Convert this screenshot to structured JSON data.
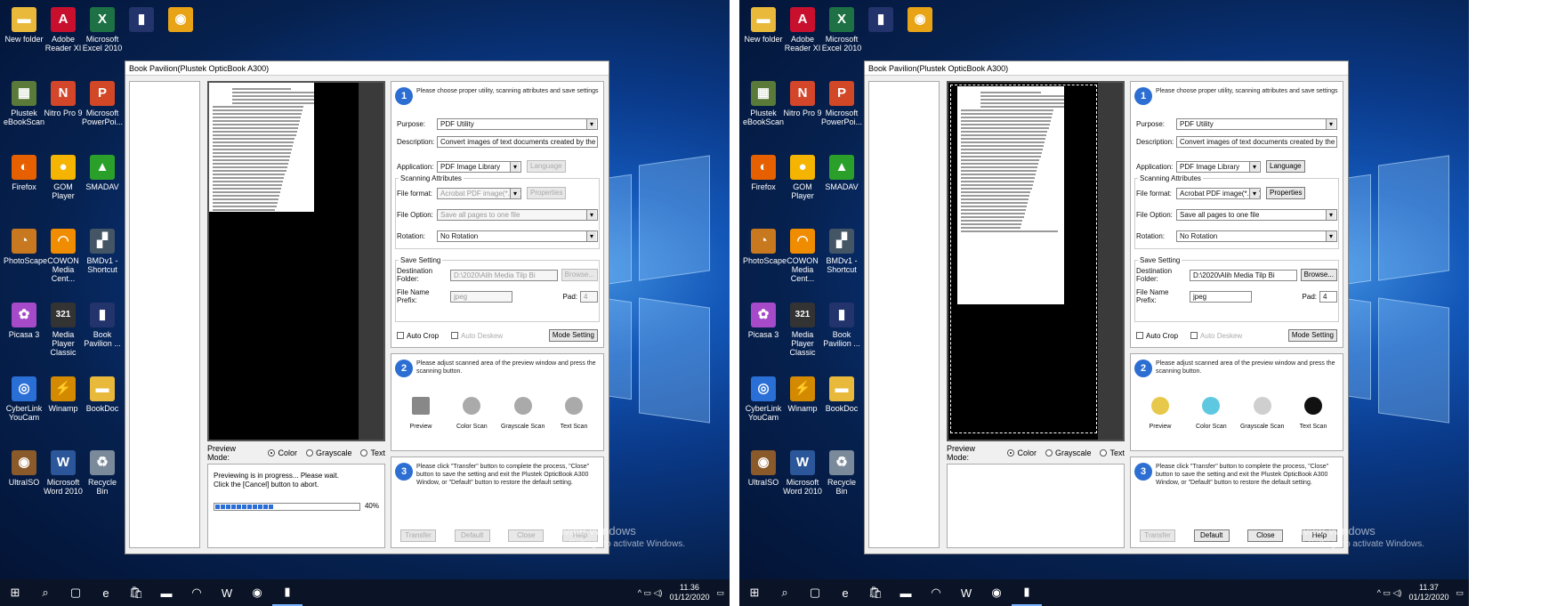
{
  "desktop": {
    "icons": [
      {
        "label": "New folder",
        "icon": "folder-icon",
        "color": "#e8b93a",
        "glyph": "▬"
      },
      {
        "label": "Adobe Reader XI",
        "icon": "adobe-reader-icon",
        "color": "#c8102e",
        "glyph": "A"
      },
      {
        "label": "Microsoft Excel 2010",
        "icon": "excel-icon",
        "color": "#1e7145",
        "glyph": "X"
      },
      {
        "label": "",
        "icon": "book-pavilion-small-icon",
        "color": "#23336b",
        "glyph": "▮"
      },
      {
        "label": "",
        "icon": "chrome-icon",
        "color": "#e8a317",
        "glyph": "◉"
      },
      {
        "label": "Plustek eBookScan",
        "icon": "plustek-icon",
        "color": "#5a7a3a",
        "glyph": "▦"
      },
      {
        "label": "Nitro Pro 9",
        "icon": "nitro-icon",
        "color": "#d4462a",
        "glyph": "N"
      },
      {
        "label": "Microsoft PowerPoi...",
        "icon": "powerpoint-icon",
        "color": "#d24726",
        "glyph": "P"
      },
      {
        "label": "Firefox",
        "icon": "firefox-icon",
        "color": "#e66000",
        "glyph": "◐"
      },
      {
        "label": "GOM Player",
        "icon": "gom-player-icon",
        "color": "#f5b400",
        "glyph": "●"
      },
      {
        "label": "SMADAV",
        "icon": "smadav-icon",
        "color": "#2aa02a",
        "glyph": "▲"
      },
      {
        "label": "PhotoScape",
        "icon": "photoscape-icon",
        "color": "#c8781e",
        "glyph": "◔"
      },
      {
        "label": "COWON Media Cent...",
        "icon": "cowon-icon",
        "color": "#f08c00",
        "glyph": "◠"
      },
      {
        "label": "BMDv1 - Shortcut",
        "icon": "bmdv1-icon",
        "color": "#445566",
        "glyph": "▞"
      },
      {
        "label": "Picasa 3",
        "icon": "picasa-icon",
        "color": "#a64ac9",
        "glyph": "✿"
      },
      {
        "label": "Media Player Classic",
        "icon": "media-player-classic-icon",
        "color": "#333333",
        "glyph": "321"
      },
      {
        "label": "Book Pavilion ...",
        "icon": "book-pavilion-icon",
        "color": "#23336b",
        "glyph": "▮"
      },
      {
        "label": "CyberLink YouCam",
        "icon": "youcam-icon",
        "color": "#2a6fd6",
        "glyph": "◎"
      },
      {
        "label": "Winamp",
        "icon": "winamp-icon",
        "color": "#d48a00",
        "glyph": "⚡"
      },
      {
        "label": "BookDoc",
        "icon": "bookdoc-folder-icon",
        "color": "#e8b93a",
        "glyph": "▬"
      },
      {
        "label": "UltraISO",
        "icon": "ultraiso-icon",
        "color": "#8a5a2a",
        "glyph": "◉"
      },
      {
        "label": "Microsoft Word 2010",
        "icon": "word-icon",
        "color": "#2b579a",
        "glyph": "W"
      },
      {
        "label": "Recycle Bin",
        "icon": "recycle-bin-icon",
        "color": "#7a8a9a",
        "glyph": "♻"
      }
    ],
    "activate": {
      "line1": "Activate Windows",
      "line2": "Go to Settings to activate Windows."
    }
  },
  "taskbar": {
    "items": [
      {
        "icon": "start-icon",
        "glyph": "⊞"
      },
      {
        "icon": "search-icon",
        "glyph": "⌕"
      },
      {
        "icon": "task-view-icon",
        "glyph": "▢"
      },
      {
        "icon": "edge-icon",
        "glyph": "e"
      },
      {
        "icon": "store-icon",
        "glyph": "🛍"
      },
      {
        "icon": "file-explorer-icon",
        "glyph": "▬"
      },
      {
        "icon": "cowon-taskbar-icon",
        "glyph": "◠"
      },
      {
        "icon": "word-taskbar-icon",
        "glyph": "W"
      },
      {
        "icon": "chrome-taskbar-icon",
        "glyph": "◉"
      },
      {
        "icon": "book-pavilion-taskbar-icon",
        "glyph": "▮"
      }
    ],
    "tray_icons": "^ ▭ ◁)"
  },
  "screens": [
    {
      "time": "11.36",
      "date": "01/12/2020",
      "window_title": "Book Pavilion(Plustek OpticBook A300)",
      "step1": "Please choose proper utility, scanning attributes and save settings",
      "purpose_label": "Purpose:",
      "purpose": "PDF Utility",
      "description_label": "Description:",
      "description": "Convert images of text documents created by the",
      "application_label": "Application:",
      "application": "PDF Image Library",
      "language_btn": "Language",
      "scan_attr_label": "Scanning Attributes",
      "file_format_label": "File format:",
      "file_format": "Acrobat PDF image(*.pdf)",
      "properties_btn": "Properties",
      "file_option_label": "File Option:",
      "file_option": "Save all pages to one file",
      "rotation_label": "Rotation:",
      "rotation": "No Rotation",
      "save_setting_label": "Save Setting",
      "dest_folder_label": "Destination Folder:",
      "dest_folder": "D:\\2020\\Alih Media Tilp Bi",
      "browse_btn": "Browse...",
      "prefix_label": "File Name Prefix:",
      "prefix": "jpeg",
      "pad_label": "Pad:",
      "pad": "4",
      "auto_crop": "Auto Crop",
      "auto_deskew": "Auto Deskew",
      "mode_setting_btn": "Mode Setting",
      "step2": "Please adjust scanned area of the preview window and press the scanning button.",
      "scan_buttons": [
        "Preview",
        "Color Scan",
        "Grayscale Scan",
        "Text Scan"
      ],
      "step3": "Please click \"Transfer\" button to complete the process, \"Close\" button to save the setting and exit the Plustek OpticBook A300 Window, or \"Default\" button to restore the default setting.",
      "preview_mode_label": "Preview Mode:",
      "mode_color": "Color",
      "mode_gray": "Grayscale",
      "mode_text": "Text",
      "progress_line1": "Previewing is in progress... Please wait.",
      "progress_line2": "Click the [Cancel] button to abort.",
      "progress_percent": "40%",
      "progress_value": 0.4,
      "actions": [
        "Transfer",
        "Default",
        "Close",
        "Help"
      ]
    },
    {
      "time": "11.37",
      "date": "01/12/2020",
      "window_title": "Book Pavilion(Plustek OpticBook A300)",
      "step1": "Please choose proper utility, scanning attributes and save settings",
      "purpose_label": "Purpose:",
      "purpose": "PDF Utility",
      "description_label": "Description:",
      "description": "Convert images of text documents created by the",
      "application_label": "Application:",
      "application": "PDF Image Library",
      "language_btn": "Language",
      "scan_attr_label": "Scanning Attributes",
      "file_format_label": "File format:",
      "file_format": "Acrobat PDF image(*.pdf)",
      "properties_btn": "Properties",
      "file_option_label": "File Option:",
      "file_option": "Save all pages to one file",
      "rotation_label": "Rotation:",
      "rotation": "No Rotation",
      "save_setting_label": "Save Setting",
      "dest_folder_label": "Destination Folder:",
      "dest_folder": "D:\\2020\\Alih Media Tilp Bi",
      "browse_btn": "Browse...",
      "prefix_label": "File Name Prefix:",
      "prefix": "jpeg",
      "pad_label": "Pad:",
      "pad": "4",
      "auto_crop": "Auto Crop",
      "auto_deskew": "Auto Deskew",
      "mode_setting_btn": "Mode Setting",
      "step2": "Please adjust scanned area of the preview window and press the scanning button.",
      "scan_buttons": [
        "Preview",
        "Color Scan",
        "Grayscale Scan",
        "Text Scan"
      ],
      "step3": "Please click \"Transfer\" button to complete the process, \"Close\" button to save the setting and exit the Plustek OpticBook A300 Window, or \"Default\" button to restore the default setting.",
      "preview_mode_label": "Preview Mode:",
      "mode_color": "Color",
      "mode_gray": "Grayscale",
      "mode_text": "Text",
      "actions": [
        "Transfer",
        "Default",
        "Close",
        "Help"
      ]
    }
  ]
}
